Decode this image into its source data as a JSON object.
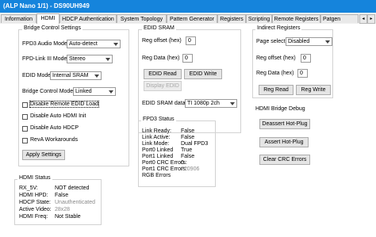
{
  "window": {
    "title": "(ALP Nano 1/1) - DS90UH949"
  },
  "tabs": [
    {
      "label": "Information"
    },
    {
      "label": "HDMI"
    },
    {
      "label": "HDCP Authentication"
    },
    {
      "label": "System Topology"
    },
    {
      "label": "Pattern Generator"
    },
    {
      "label": "Registers"
    },
    {
      "label": "Scripting"
    },
    {
      "label": "Remote Registers"
    },
    {
      "label": "Patgen"
    }
  ],
  "bridge": {
    "title": "Bridge Control Settings",
    "fpd3_audio_label": "FPD3 Audio Mode",
    "fpd3_audio_value": "Auto-detect",
    "fpdlink_label": "FPD-Link III Mode",
    "fpdlink_value": "Stereo",
    "edid_mode_label": "EDID Mode",
    "edid_mode_value": "Internal SRAM",
    "bridge_ctrl_label": "Bridge Control Mode",
    "bridge_ctrl_value": "Linked",
    "cb_disable_remote_edid": "Disable Remote EDID Load",
    "cb_disable_auto_hdmi": "Disable Auto HDMI Init",
    "cb_disable_auto_hdcp": "Disable Auto HDCP",
    "cb_reva": "RevA Workarounds",
    "apply_button": "Apply Settings"
  },
  "edid": {
    "title": "EDID SRAM",
    "reg_offset_label": "Reg offset (hex)",
    "reg_offset_value": "0",
    "reg_data_label": "Reg Data (hex)",
    "reg_data_value": "0",
    "read_button": "EDID Read",
    "write_button": "EDID Write",
    "display_button": "Display EDID",
    "sram_data_label": "EDID SRAM data",
    "sram_data_value": "TI 1080p 2ch"
  },
  "fpd3_status": {
    "title": "FPD3 Status",
    "rows": [
      {
        "k": "Link Ready:",
        "v": "False"
      },
      {
        "k": "Link Active:",
        "v": "False"
      },
      {
        "k": "Link Mode:",
        "v": "Dual FPD3"
      },
      {
        "k": "Port0 Linked",
        "v": "True"
      },
      {
        "k": "Port1 Linked",
        "v": "False"
      },
      {
        "k": "Port0 CRC Errors:",
        "v": "0"
      },
      {
        "k": "Port1 CRC Errors:",
        "v": "720906"
      },
      {
        "k": "RGB Errors",
        "v": ""
      }
    ]
  },
  "indirect": {
    "title": "Indirect Registers",
    "page_select_label": "Page select",
    "page_select_value": "Disabled",
    "reg_offset_label": "Reg offset (hex)",
    "reg_offset_value": "0",
    "reg_data_label": "Reg Data (hex)",
    "reg_data_value": "0",
    "read_button": "Reg Read",
    "write_button": "Reg Write"
  },
  "hdmi_debug": {
    "title": "HDMI Bridge Debug",
    "deassert_button": "Deassert Hot-Plug",
    "assert_button": "Assert Hot-Plug",
    "clear_crc_button": "Clear CRC Errors"
  },
  "hdmi_status": {
    "title": "HDMI Status",
    "rows": [
      {
        "k": "RX_5V:",
        "v": "NOT detected"
      },
      {
        "k": "HDMI HPD:",
        "v": "False"
      },
      {
        "k": "HDCP State:",
        "v": "Unauthenticated"
      },
      {
        "k": "Active Video:",
        "v": "28x28"
      },
      {
        "k": "HDMI Freq:",
        "v": "Not Stable"
      }
    ]
  }
}
